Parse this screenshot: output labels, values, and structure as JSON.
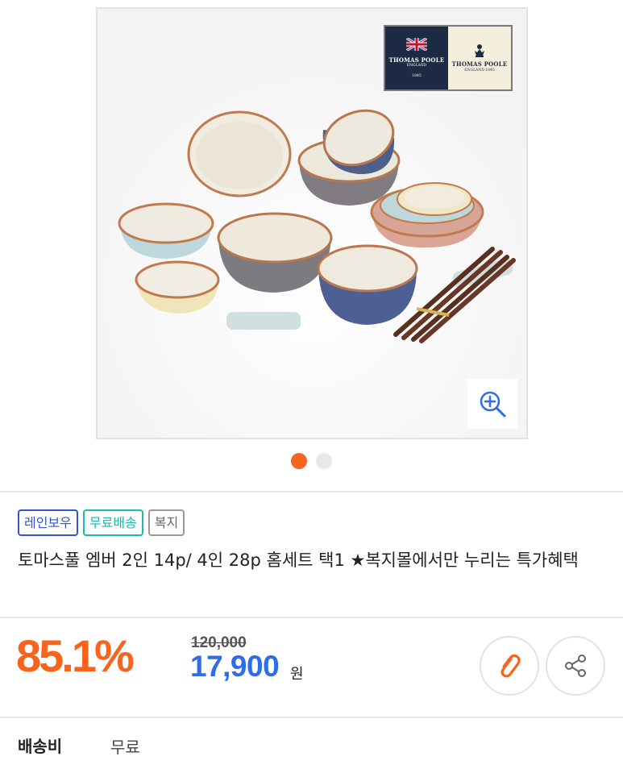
{
  "gallery": {
    "brand_logo": {
      "left_name": "THOMAS POOLE",
      "left_sub": "ENGLAND",
      "left_year": "1845",
      "right_name": "THOMAS POOLE",
      "right_sub": "ENGLAND 1845"
    },
    "zoom_icon": "zoom-in-icon",
    "pager": {
      "total": 2,
      "active": 1
    }
  },
  "product": {
    "badges": [
      {
        "label": "레인보우",
        "color": "#3056d3"
      },
      {
        "label": "무료배송",
        "color": "#1cbab0"
      },
      {
        "label": "복지",
        "color": "#999999"
      }
    ],
    "title": "토마스풀 엠버 2인 14p/ 4인 28p 홈세트 택1 ★복지몰에서만 누리는 특가혜택"
  },
  "pricing": {
    "discount": "85.1%",
    "original_price": "120,000",
    "sale_price": "17,900",
    "currency": "원",
    "accent_color": "#f7641c",
    "price_color": "#2f6ce5"
  },
  "actions": {
    "clip_icon": "paperclip-icon",
    "share_icon": "share-icon"
  },
  "shipping": {
    "label": "배송비",
    "value": "무료"
  }
}
